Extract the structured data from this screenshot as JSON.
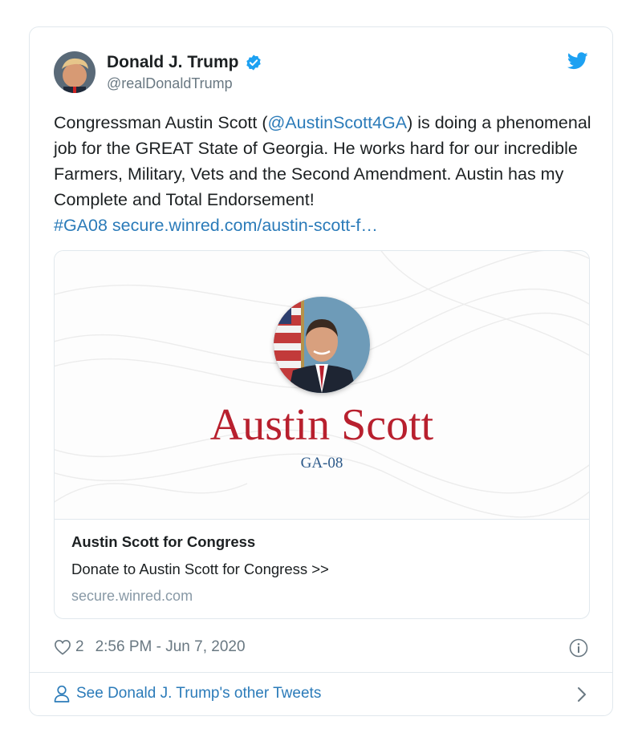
{
  "author": {
    "name": "Donald J. Trump",
    "handle": "@realDonaldTrump",
    "verified": true
  },
  "tweet": {
    "text_before_mention": "Congressman Austin Scott (",
    "mention": "@AustinScott4GA",
    "text_after_mention": ") is doing a phenomenal job for the GREAT State of Georgia. He works hard for our incredible Farmers, Military, Vets and the Second Amendment. Austin has my Complete and Total Endorsement!",
    "hashtag": "#GA08",
    "url": "secure.winred.com/austin-scott-f…"
  },
  "card": {
    "image_name": "Austin Scott",
    "image_district": "GA-08",
    "title": "Austin Scott for Congress",
    "description": "Donate to Austin Scott for Congress >>",
    "domain": "secure.winred.com"
  },
  "meta": {
    "like_count": "2",
    "timestamp": "2:56 PM - Jun 7, 2020"
  },
  "footer": {
    "link_label": "See Donald J. Trump's other Tweets"
  },
  "icons": {
    "bird": "twitter-bird-icon",
    "verified": "verified-badge-icon",
    "heart": "heart-icon",
    "info": "info-icon",
    "user": "user-icon",
    "chevron": "chevron-right-icon"
  },
  "colors": {
    "link": "#2b7bb9",
    "twitter_blue": "#1da1f2",
    "candidate_red": "#b8202e",
    "district_blue": "#2d5a8a"
  }
}
